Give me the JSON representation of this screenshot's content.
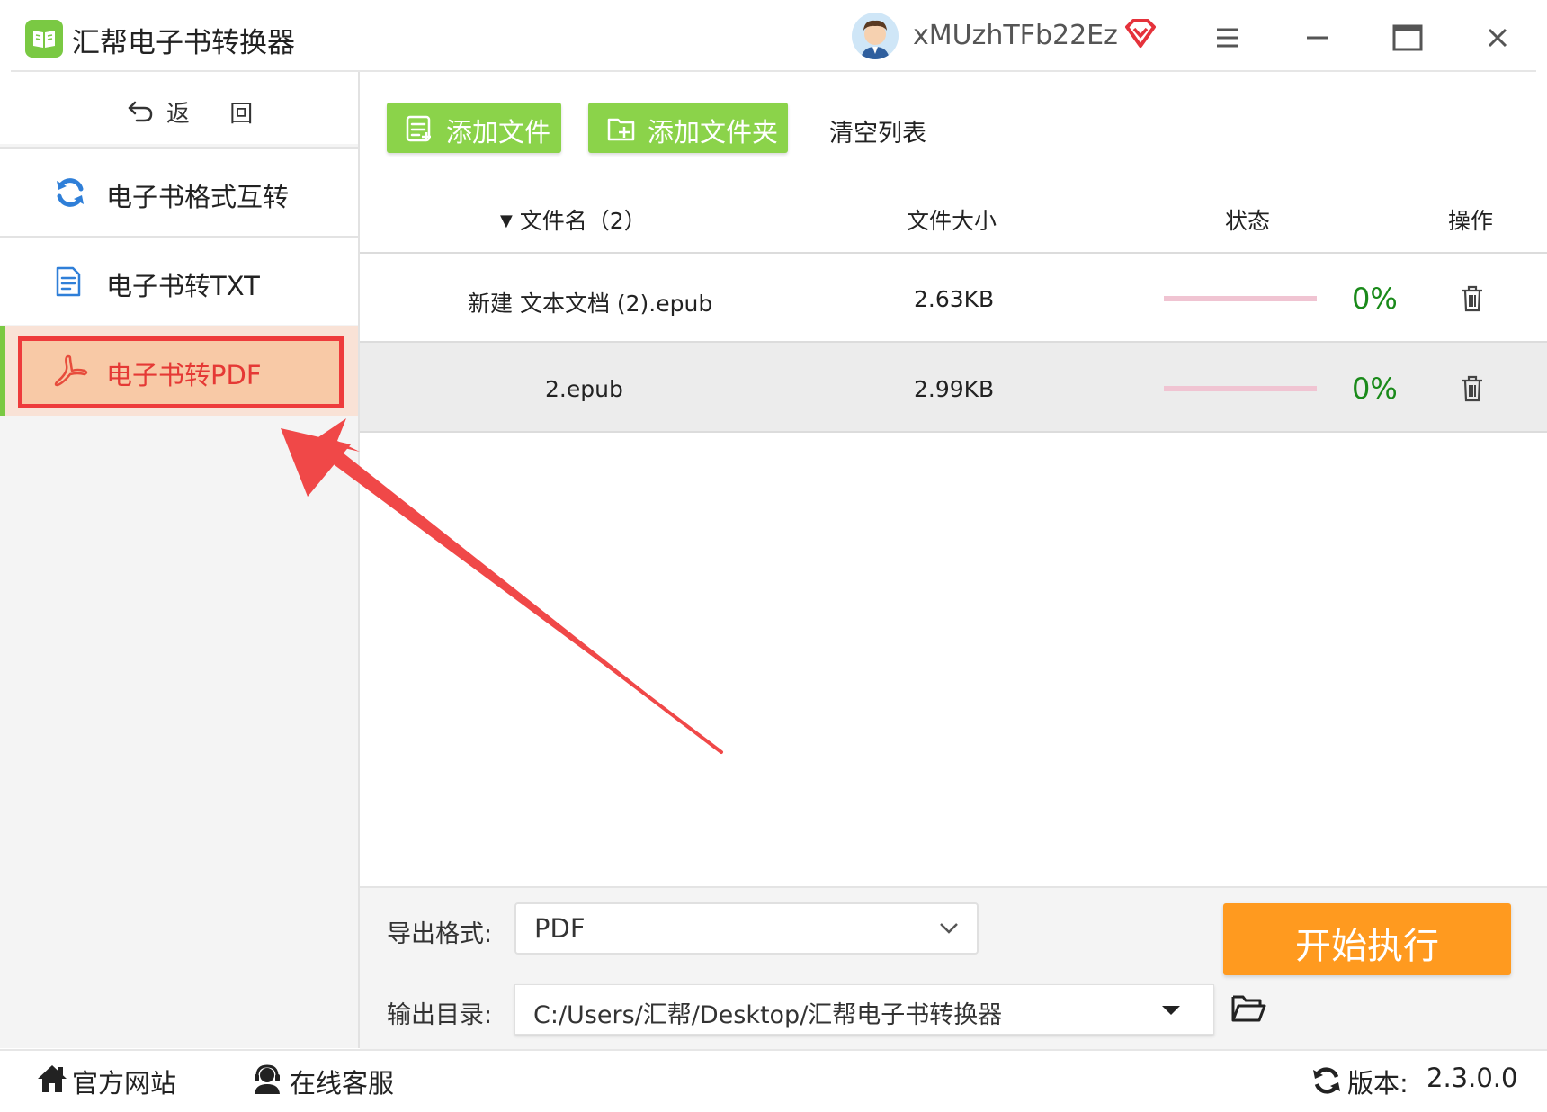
{
  "app": {
    "title": "汇帮电子书转换器",
    "username": "xMUzhTFb22Ez"
  },
  "sidebar": {
    "back_label": "返 回",
    "items": [
      {
        "label": "电子书格式互转"
      },
      {
        "label": "电子书转TXT"
      },
      {
        "label": "电子书转PDF",
        "active": true
      }
    ]
  },
  "toolbar": {
    "add_file_label": "添加文件",
    "add_folder_label": "添加文件夹",
    "clear_list_label": "清空列表"
  },
  "table": {
    "columns": [
      "文件名（2）",
      "文件大小",
      "状态",
      "操作"
    ],
    "rows": [
      {
        "name": "新建 文本文档 (2).epub",
        "size": "2.63KB",
        "progress": "0%"
      },
      {
        "name": "2.epub",
        "size": "2.99KB",
        "progress": "0%"
      }
    ]
  },
  "settings": {
    "export_format_label": "导出格式:",
    "export_format_value": "PDF",
    "output_dir_label": "输出目录:",
    "output_dir_value": "C:/Users/汇帮/Desktop/汇帮电子书转换器",
    "start_label": "开始执行"
  },
  "footer": {
    "website_label": "官方网站",
    "support_label": "在线客服",
    "version_label": "版本:",
    "version_value": "2.3.0.0"
  },
  "colors": {
    "accent_green": "#8bd34a",
    "start_orange": "#ff9a1f",
    "highlight_red": "#ee3b3b",
    "progress_pink": "#f0c4d2",
    "percent_green": "#1a8a1a"
  }
}
